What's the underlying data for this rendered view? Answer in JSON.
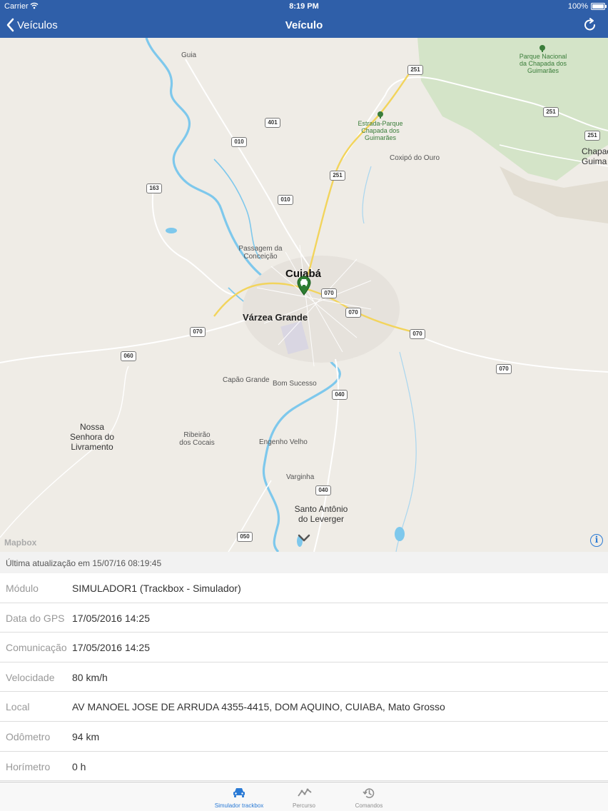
{
  "status_bar": {
    "carrier": "Carrier",
    "time": "8:19 PM",
    "battery": "100%"
  },
  "nav": {
    "back_label": "Veículos",
    "title": "Veículo"
  },
  "map": {
    "labels": {
      "guia": "Guia",
      "parque_nacional": "Parque Nacional da Chapada dos Guimarães",
      "estrada_parque": "Estrada-Parque Chapada dos Guimarães",
      "coxipo": "Coxipó do Ouro",
      "chapada": "Chapada Guima",
      "passagem": "Passagem da Conceição",
      "cuiaba": "Cuiabá",
      "varzea": "Várzea Grande",
      "capao": "Capão Grande",
      "bom_sucesso": "Bom Sucesso",
      "nossa_senhora": "Nossa Senhora do Livramento",
      "ribeirao": "Ribeirão dos Cocais",
      "engenho": "Engenho Velho",
      "varginha": "Varginha",
      "santo_antonio": "Santo Antônio do Leverger"
    },
    "shields": {
      "s251a": "251",
      "s251b": "251",
      "s251c": "251",
      "s251d": "251",
      "s401": "401",
      "s010a": "010",
      "s010b": "010",
      "s163": "163",
      "s070a": "070",
      "s070b": "070",
      "s070c": "070",
      "s070d": "070",
      "s070e": "070",
      "s060": "060",
      "s040a": "040",
      "s040b": "040",
      "s050": "050"
    },
    "attribution": "Mapbox",
    "info_symbol": "i"
  },
  "last_update": "Última atualização em 15/07/16 08:19:45",
  "details": [
    {
      "key": "Módulo",
      "value": "SIMULADOR1 (Trackbox - Simulador)"
    },
    {
      "key": "Data do GPS",
      "value": "17/05/2016 14:25"
    },
    {
      "key": "Comunicação",
      "value": "17/05/2016 14:25"
    },
    {
      "key": "Velocidade",
      "value": "80 km/h"
    },
    {
      "key": "Local",
      "value": "AV MANOEL JOSE DE ARRUDA 4355-4415, DOM AQUINO, CUIABA, Mato Grosso"
    },
    {
      "key": "Odômetro",
      "value": "94 km"
    },
    {
      "key": "Horímetro",
      "value": "0 h"
    }
  ],
  "tabs": [
    {
      "label": "Simulador trackbox",
      "icon": "car-icon",
      "active": true
    },
    {
      "label": "Percurso",
      "icon": "route-icon",
      "active": false
    },
    {
      "label": "Comandos",
      "icon": "history-icon",
      "active": false
    }
  ],
  "colors": {
    "nav_bg": "#2f5fa9",
    "accent": "#2a7ad5",
    "marker": "#2e7d32",
    "water": "#7ec8ec",
    "park": "#cfe3c2",
    "road_major": "#f2d45c"
  }
}
